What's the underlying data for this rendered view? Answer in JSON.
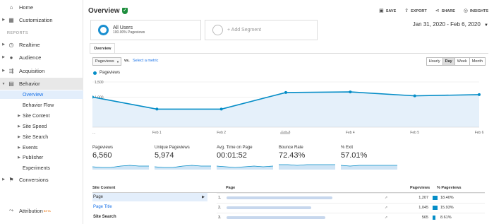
{
  "sidebar": {
    "home": "Home",
    "customization": "Customization",
    "reports_heading": "REPORTS",
    "realtime": "Realtime",
    "audience": "Audience",
    "acquisition": "Acquisition",
    "behavior": "Behavior",
    "sub": {
      "overview": "Overview",
      "behavior_flow": "Behavior Flow",
      "site_content": "Site Content",
      "site_speed": "Site Speed",
      "site_search": "Site Search",
      "events": "Events",
      "publisher": "Publisher",
      "experiments": "Experiments"
    },
    "conversions": "Conversions",
    "attribution": "Attribution",
    "beta": "BETA"
  },
  "header": {
    "title": "Overview",
    "save": "SAVE",
    "export": "EXPORT",
    "share": "SHARE",
    "insights": "INSIGHTS"
  },
  "segments": {
    "all_users": "All Users",
    "all_users_sub": "100.00% Pageviews",
    "add_segment": "+ Add Segment"
  },
  "date_range": "Jan 31, 2020 - Feb 6, 2020",
  "tab_overview": "Overview",
  "metric_select": "Pageviews",
  "vs": "vs.",
  "select_metric": "Select a metric",
  "granularity": [
    "Hourly",
    "Day",
    "Week",
    "Month"
  ],
  "legend_series": "Pageviews",
  "chart_data": {
    "type": "area",
    "x": [
      "Jan 31",
      "Feb 1",
      "Feb 2",
      "Feb 3",
      "Feb 4",
      "Feb 5",
      "Feb 6"
    ],
    "x_tick_labels": [
      "...",
      "Feb 1",
      "Feb 2",
      "Feb 3",
      "Feb 4",
      "Feb 5",
      "Feb 6"
    ],
    "series": [
      {
        "name": "Pageviews",
        "values": [
          1000,
          600,
          600,
          1150,
          1170,
          1040,
          1080
        ]
      }
    ],
    "y_ticks": [
      "500",
      "1,000",
      "1,500"
    ],
    "ylim": [
      0,
      1500
    ],
    "color": "#058dc7",
    "grid": true
  },
  "metrics": [
    {
      "label": "Pageviews",
      "value": "6,560"
    },
    {
      "label": "Unique Pageviews",
      "value": "5,974"
    },
    {
      "label": "Avg. Time on Page",
      "value": "00:01:52"
    },
    {
      "label": "Bounce Rate",
      "value": "72.43%"
    },
    {
      "label": "% Exit",
      "value": "57.01%"
    }
  ],
  "site_content": {
    "heading": "Site Content",
    "rows": [
      "Page",
      "Page Title",
      "Site Search"
    ]
  },
  "table": {
    "col_page": "Page",
    "col_pageviews": "Pageviews",
    "col_pct": "% Pageviews",
    "rows": [
      {
        "n": "1.",
        "pv": "1,207",
        "pct": "18.40%",
        "frac": 0.184
      },
      {
        "n": "2.",
        "pv": "1,045",
        "pct": "15.93%",
        "frac": 0.1593
      },
      {
        "n": "3.",
        "pv": "565",
        "pct": "8.61%",
        "frac": 0.0861
      }
    ]
  }
}
